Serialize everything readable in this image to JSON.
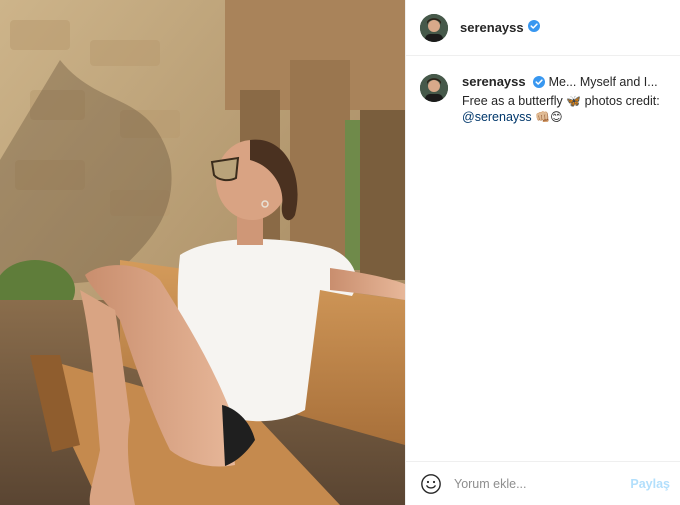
{
  "post": {
    "author": {
      "username": "serenayss",
      "verified": true
    },
    "caption": {
      "username": "serenayss",
      "text": "Me... Myself and I... Free as a butterfly",
      "butterfly_emoji": "🦋",
      "text_after": "photos credit:",
      "mention": "@serenayss",
      "trailing_emojis": "👊🏼😊"
    },
    "comment_box": {
      "placeholder": "Yorum ekle...",
      "value": "",
      "share_label": "Paylaş"
    }
  },
  "colors": {
    "verified_badge": "#3897f0",
    "mention": "#00376b",
    "share_disabled": "#b2dffc"
  },
  "icons": {
    "verified": "verified-badge-icon",
    "emoji": "smile-icon"
  }
}
